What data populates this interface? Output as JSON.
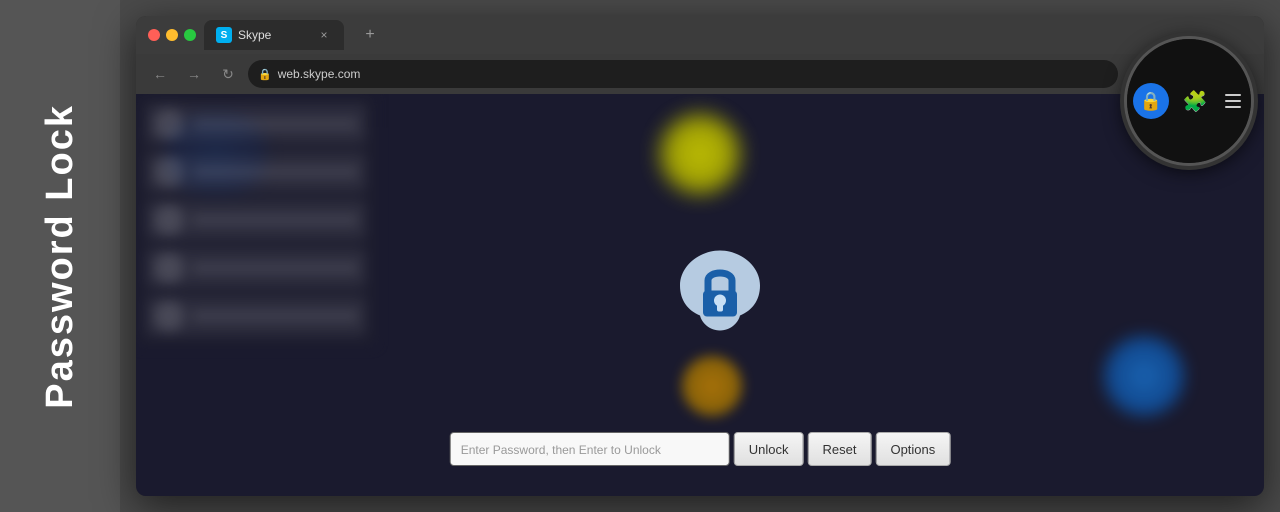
{
  "sidebar": {
    "title": "Password Lock"
  },
  "browser": {
    "tab": {
      "favicon_letter": "S",
      "title": "Skype",
      "close_label": "×"
    },
    "new_tab_label": "+",
    "address": "web.skype.com",
    "nav": {
      "back": "←",
      "forward": "→",
      "reload": "↻"
    }
  },
  "toolbar": {
    "ext_icon": "🔒",
    "puzzle_label": "🧩",
    "menu_label": "⋮",
    "chevron": "˅"
  },
  "magnifier": {
    "ext_icon_symbol": "🔒",
    "puzzle_symbol": "🧩"
  },
  "password_bar": {
    "placeholder": "Enter Password, then Enter to Unlock",
    "unlock_label": "Unlock",
    "reset_label": "Reset",
    "options_label": "Options"
  }
}
